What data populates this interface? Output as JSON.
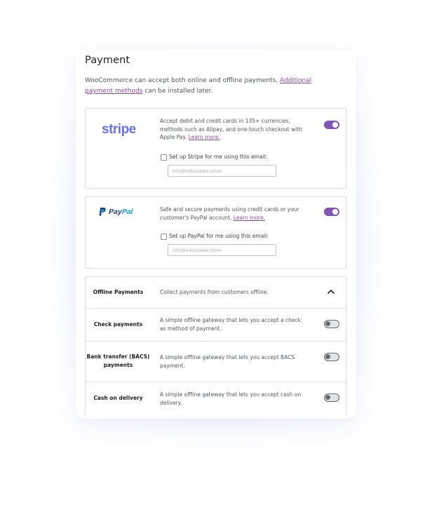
{
  "header": {
    "title": "Payment",
    "intro_text": "WooCommerce can accept both online and offline payments.",
    "intro_link": "Additional payment methods",
    "intro_suffix": "can be installed later."
  },
  "stripe": {
    "logo_text": "stripe",
    "description": "Accept debit and credit cards in 135+ currencies, methods such as Alipay, and one-touch checkout with Apple Pay.",
    "learn_more": "Learn more.",
    "checkbox_label": "Set up Stripe for me using this email:",
    "email_value": "info@inkululeko.store",
    "enabled": true
  },
  "paypal": {
    "logo_text_1": "Pay",
    "logo_text_2": "Pal",
    "description": "Safe and secure payments using credit cards or your customer's PayPal account.",
    "learn_more": "Learn more.",
    "checkbox_label": "Set up PayPal for me using this email:",
    "email_value": "info@inkululeko.store",
    "enabled": true
  },
  "offline": {
    "title": "Offline Payments",
    "description": "Collect payments from customers offline.",
    "expanded": true,
    "methods": [
      {
        "label": "Check payments",
        "description": "A simple offline gateway that lets you accept a check as method of payment.",
        "enabled": false
      },
      {
        "label": "Bank transfer (BACS) payments",
        "description": "A simple offline gateway that lets you accept BACS payment.",
        "enabled": false
      },
      {
        "label": "Cash on delivery",
        "description": "A simple offline gateway that lets you accept cash on delivery.",
        "enabled": false
      }
    ]
  },
  "colors": {
    "accent": "#7f54b3",
    "link": "#8a4a9c",
    "stripe_brand": "#6772e5"
  }
}
